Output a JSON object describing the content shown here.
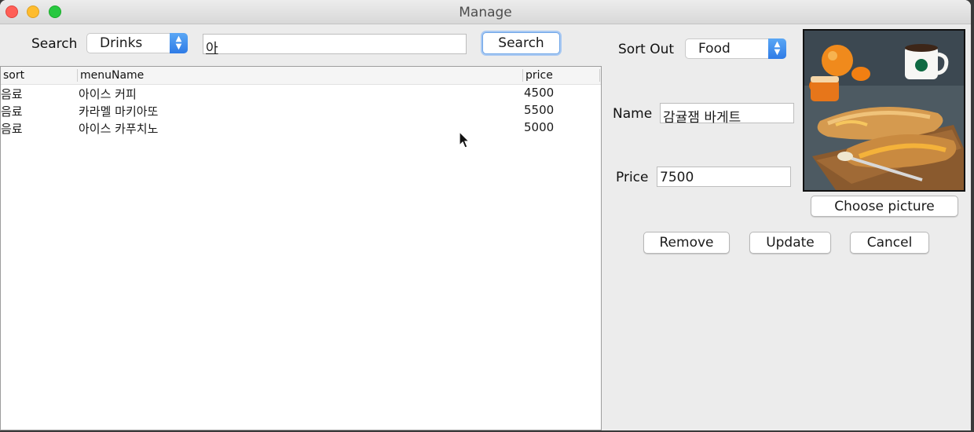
{
  "window": {
    "title": "Manage"
  },
  "search": {
    "label": "Search",
    "category": "Drinks",
    "query": "아",
    "button_label": "Search"
  },
  "table": {
    "columns": [
      "sort",
      "menuName",
      "price"
    ],
    "rows": [
      [
        "음료",
        "아이스 커피",
        "4500"
      ],
      [
        "음료",
        "카라멜 마키아또",
        "5500"
      ],
      [
        "음료",
        "아이스 카푸치노",
        "5000"
      ]
    ]
  },
  "editor": {
    "sort_label": "Sort Out",
    "sort_value": "Food",
    "name_label": "Name",
    "name_value": "감귤잼 바게트",
    "price_label": "Price",
    "price_value": "7500",
    "choose_picture_label": "Choose picture",
    "remove_label": "Remove",
    "update_label": "Update",
    "cancel_label": "Cancel"
  },
  "colors": {
    "window_bg": "#ececec",
    "accent": "#2f7be6",
    "close": "#ff5f57",
    "minimize": "#febc2e",
    "zoom": "#28c840"
  }
}
